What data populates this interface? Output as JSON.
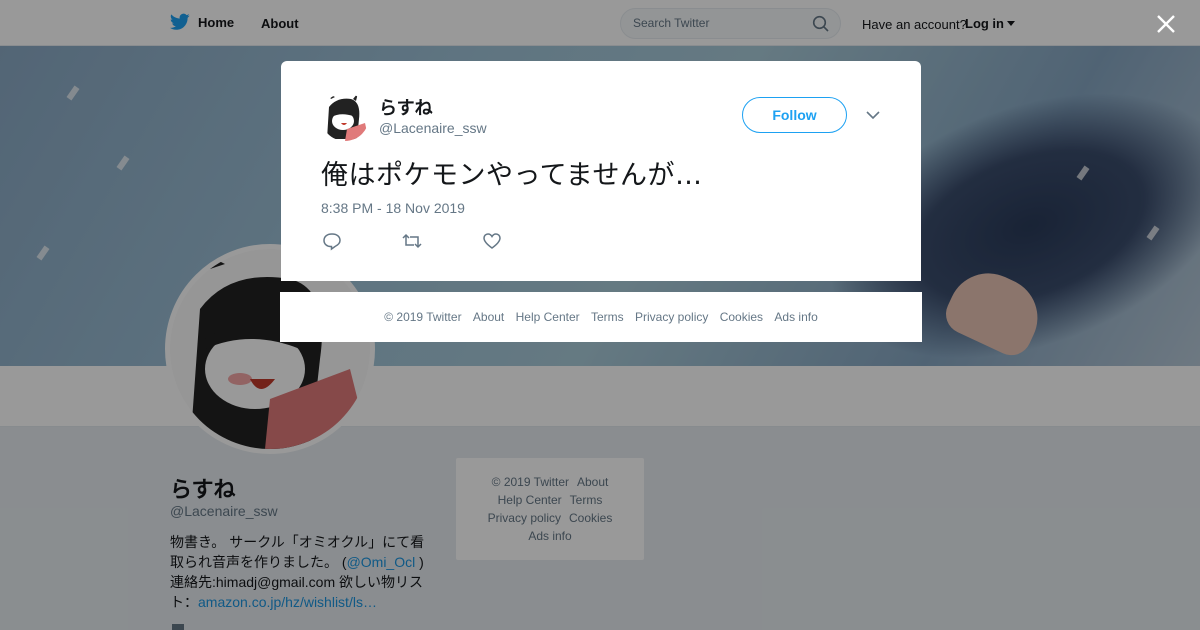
{
  "nav": {
    "home_label": "Home",
    "about_label": "About",
    "search_placeholder": "Search Twitter",
    "have_account": "Have an account?",
    "login_label": "Log in"
  },
  "profile": {
    "name": "らすね",
    "handle": "@Lacenaire_ssw",
    "bio_line1": "物書き。 サークル「オミオクル」にて看取られ音声を作りました。 (",
    "bio_mention": "@Omi_Ocl",
    "bio_line2": " ) 連絡先:himadj@gmail.com 欲しい物リスト：",
    "bio_link": "amazon.co.jp/hz/wishlist/ls…"
  },
  "side_footer": {
    "copyright": "© 2019 Twitter",
    "about": "About",
    "help": "Help Center",
    "terms": "Terms",
    "privacy": "Privacy policy",
    "cookies": "Cookies",
    "ads": "Ads info"
  },
  "tweet": {
    "author_name": "らすね",
    "author_handle": "@Lacenaire_ssw",
    "follow_label": "Follow",
    "text": "俺はポケモンやってませんが…",
    "timestamp": "8:38 PM - 18 Nov 2019"
  },
  "modal_footer": {
    "copyright": "© 2019 Twitter",
    "about": "About",
    "help": "Help Center",
    "terms": "Terms",
    "privacy": "Privacy policy",
    "cookies": "Cookies",
    "ads": "Ads info"
  },
  "colors": {
    "brand": "#1da1f2",
    "text": "#14171a",
    "secondary": "#657786"
  },
  "icons": [
    "twitter-bird-icon",
    "search-icon",
    "caret-down-icon",
    "close-icon",
    "chevron-down-icon",
    "reply-icon",
    "retweet-icon",
    "like-icon"
  ]
}
